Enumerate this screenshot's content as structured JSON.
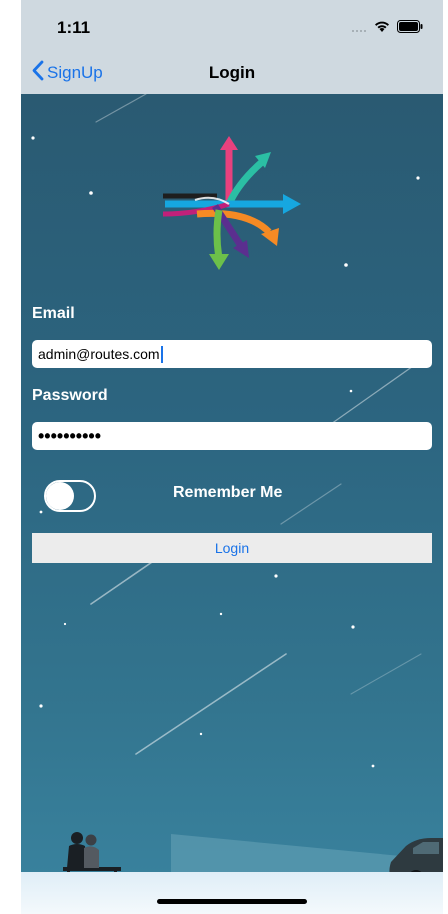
{
  "status_bar": {
    "time": "1:11"
  },
  "nav": {
    "back_label": "SignUp",
    "title": "Login"
  },
  "form": {
    "email_label": "Email",
    "email_value": "admin@routes.com",
    "password_label": "Password",
    "password_value": "••••••••••",
    "remember_label": "Remember Me",
    "remember_on": false,
    "login_label": "Login"
  },
  "icons": {
    "back": "chevron-left-icon",
    "wifi": "wifi-icon",
    "battery": "battery-icon",
    "signal": "cellular-signal-icon",
    "logo": "routes-arrows-logo"
  },
  "colors": {
    "accent": "#1a73e8",
    "nav_background": "#cfd9e0",
    "scene_top": "#2a5a72",
    "scene_bottom": "#3a84a0"
  }
}
